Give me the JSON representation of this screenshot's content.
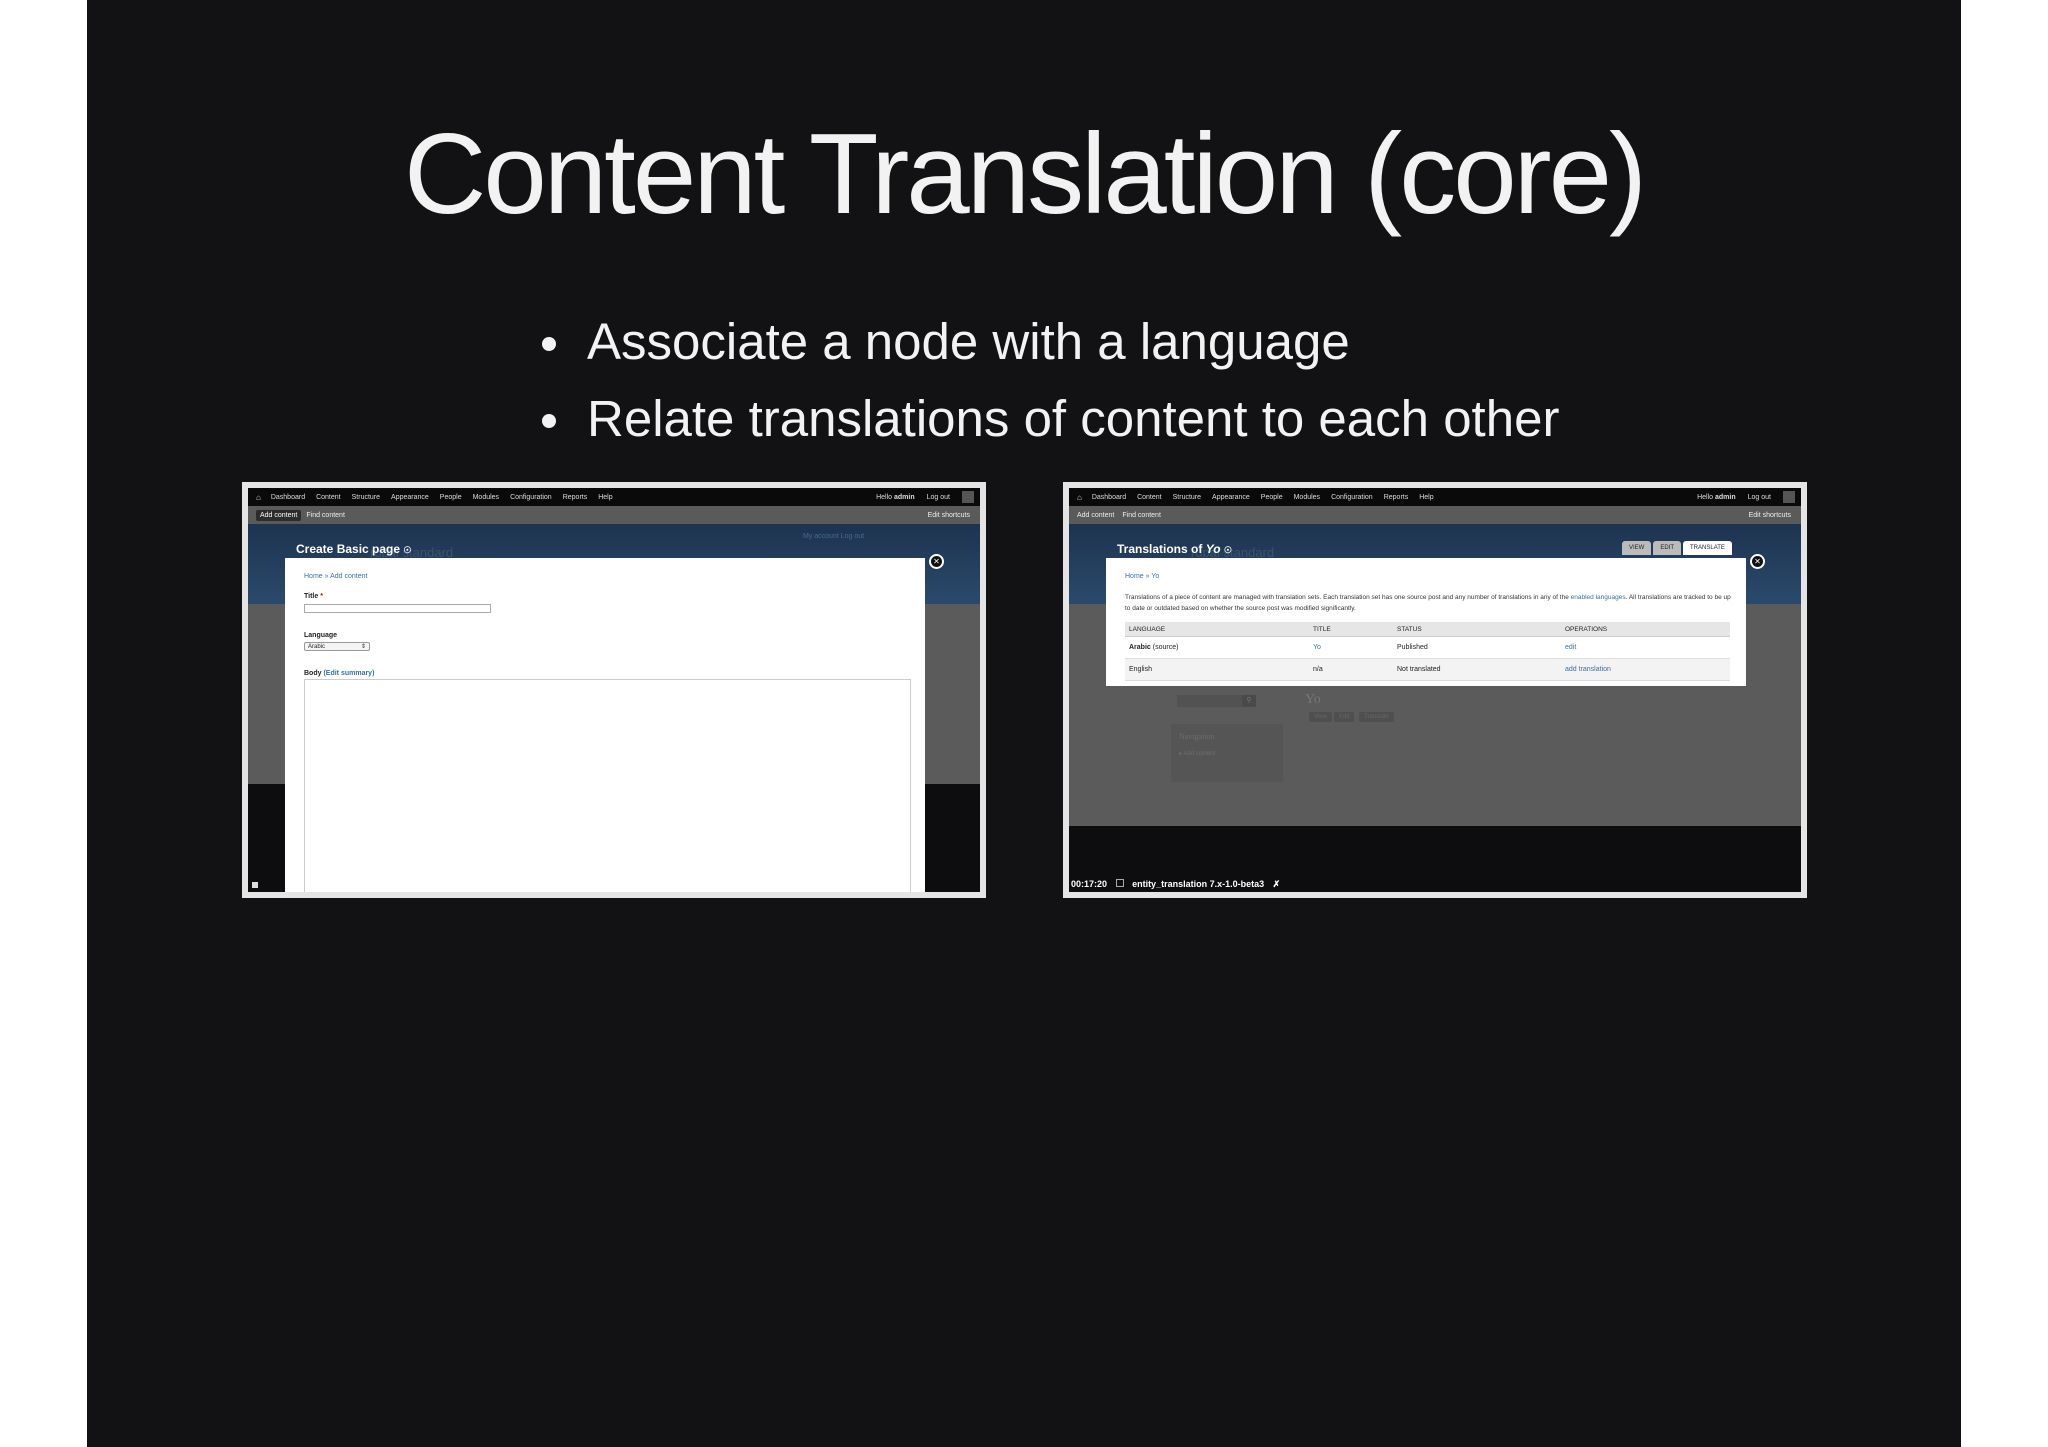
{
  "slide": {
    "title": "Content Translation (core)",
    "bullets": [
      "Associate a node with a language",
      "Relate translations of content to each other"
    ]
  },
  "toolbar": {
    "home_icon": "home-icon",
    "nav": [
      "Dashboard",
      "Content",
      "Structure",
      "Appearance",
      "People",
      "Modules",
      "Configuration",
      "Reports",
      "Help"
    ],
    "hello_prefix": "Hello ",
    "user": "admin",
    "logout": "Log out"
  },
  "shortcuts": {
    "add_content": "Add content",
    "find_content": "Find content",
    "edit_shortcuts": "Edit shortcuts"
  },
  "left_shot": {
    "page_title": "Create Basic page",
    "ghost_text": "rupal standard",
    "header_links": "My account   Log out",
    "breadcrumb": "Home » Add content",
    "title_label": "Title",
    "required_mark": "*",
    "language_label": "Language",
    "language_value": "Arabic",
    "body_label": "Body",
    "edit_summary": "(Edit summary)"
  },
  "right_shot": {
    "page_title_prefix": "Translations of ",
    "page_title_item": "Yo",
    "ghost_text": "rupal standard",
    "tabs": [
      "VIEW",
      "EDIT",
      "TRANSLATE"
    ],
    "breadcrumb": "Home » Yo",
    "description_part1": "Translations of a piece of content are managed with translation sets. Each translation set has one source post and any number of translations in any of the ",
    "description_link": "enabled languages",
    "description_part2": ". All translations are tracked to be up to date or outdated based on whether the source post was modified significantly.",
    "table": {
      "headers": [
        "LANGUAGE",
        "TITLE",
        "STATUS",
        "OPERATIONS"
      ],
      "rows": [
        {
          "language": "Arabic",
          "language_note": " (source)",
          "title": "Yo",
          "status": "Published",
          "operation": "edit"
        },
        {
          "language": "English",
          "language_note": "",
          "title": "n/a",
          "status": "Not translated",
          "operation": "add translation"
        }
      ]
    },
    "bg_node_title": "Yo",
    "bg_tabs": [
      "View",
      "Edit",
      "Translate"
    ],
    "bg_nav_heading": "Navigation",
    "bg_nav_item": "Add content",
    "status_time": "00:17:20",
    "status_label": "entity_translation 7.x-1.0-beta3"
  }
}
